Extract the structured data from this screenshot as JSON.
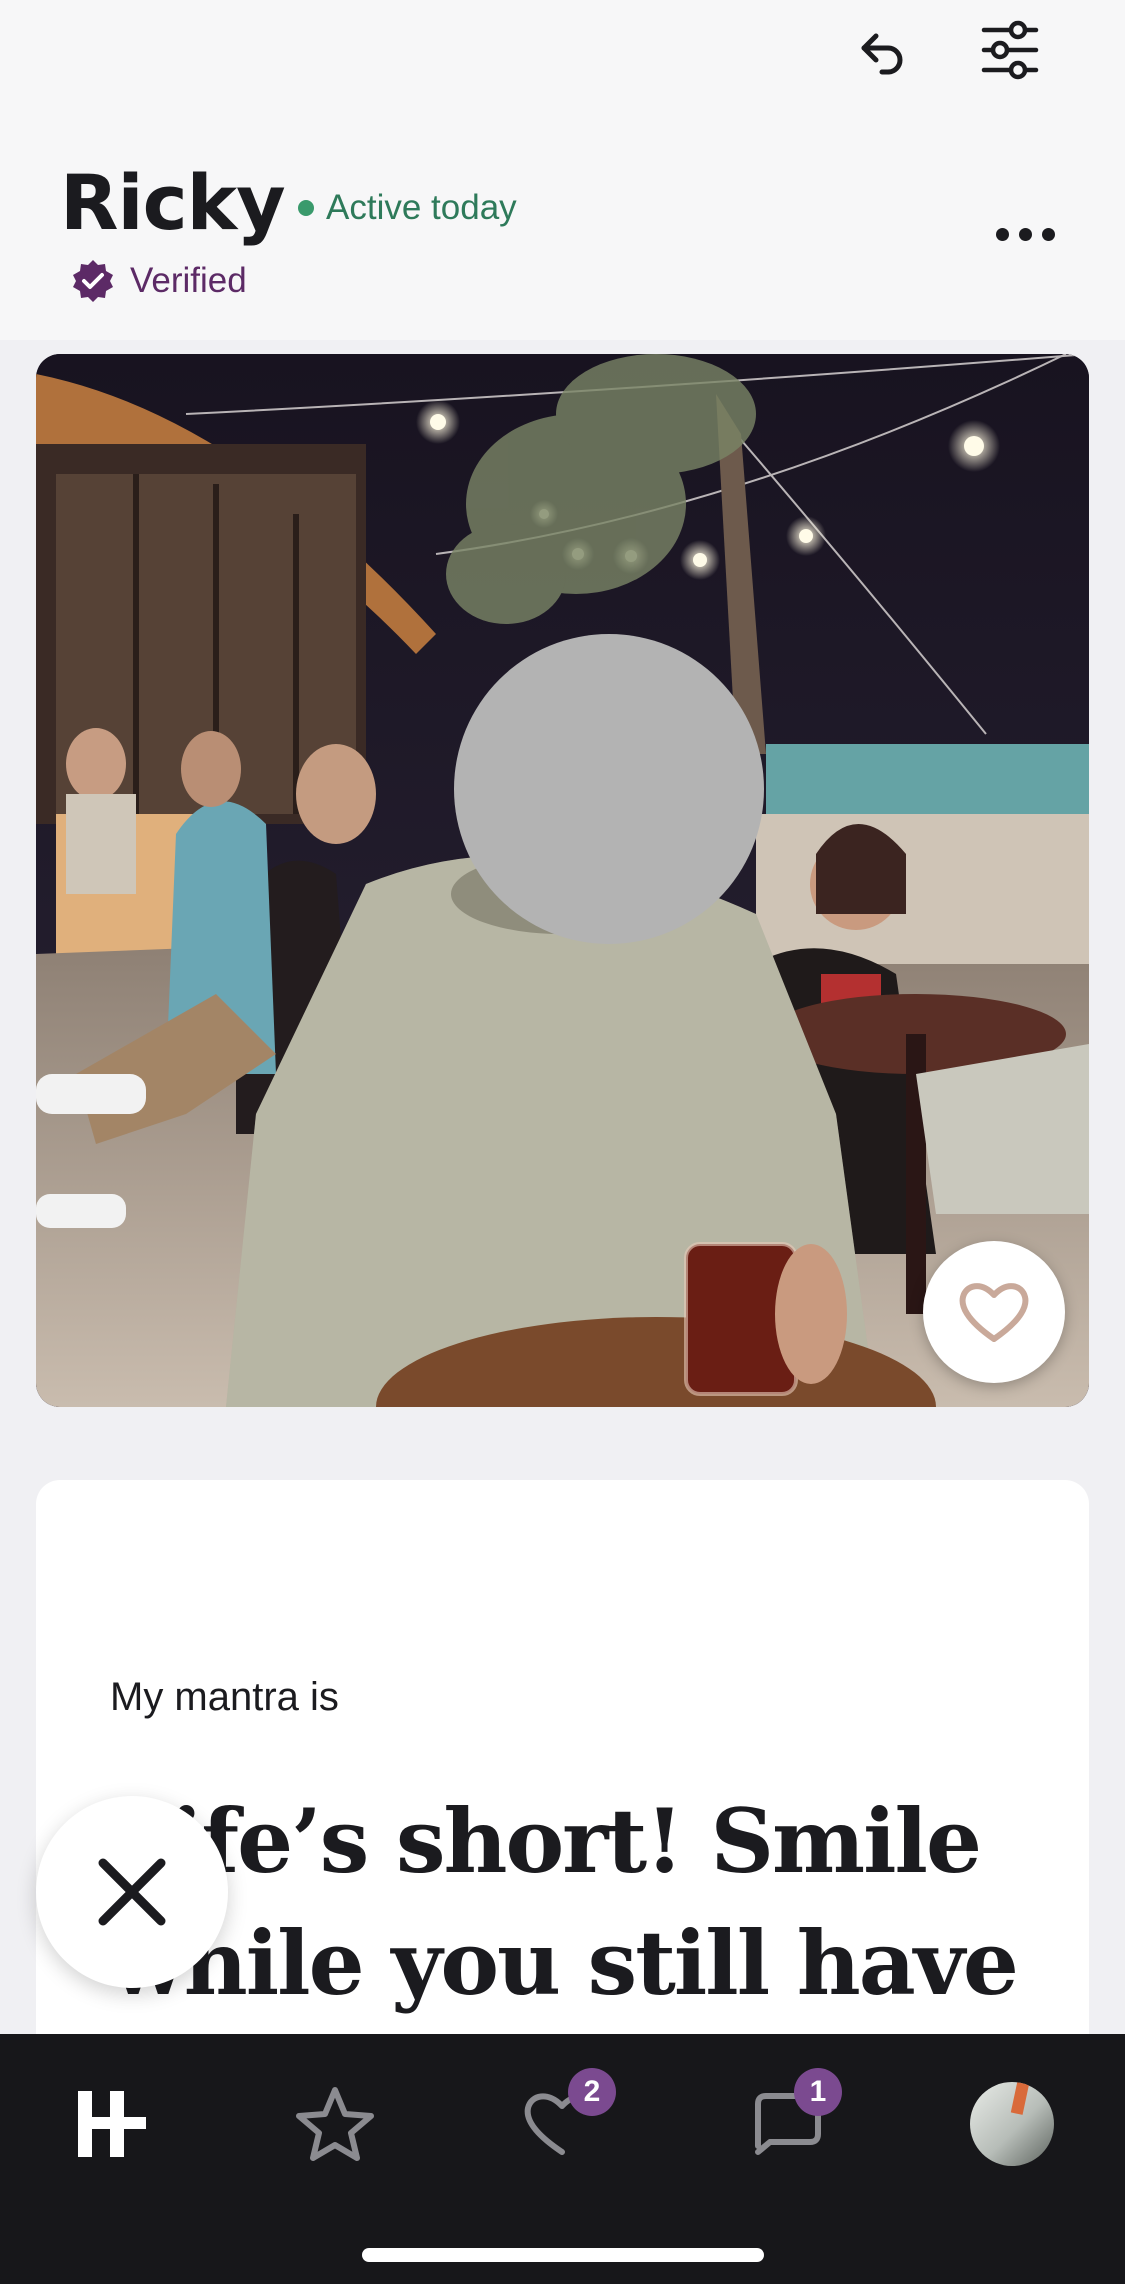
{
  "profile": {
    "name": "Ricky",
    "status": "Active today",
    "verified_label": "Verified"
  },
  "prompt": {
    "label": "My mantra is",
    "answer": "Life’s short! Smile while you still have"
  },
  "tabs": [
    {
      "name": "home",
      "icon": "hinge-logo-icon",
      "badge": ""
    },
    {
      "name": "standouts",
      "icon": "star-icon",
      "badge": ""
    },
    {
      "name": "likes-you",
      "icon": "heart-icon",
      "badge": "2"
    },
    {
      "name": "matches",
      "icon": "chat-icon",
      "badge": "1"
    },
    {
      "name": "profile",
      "icon": "avatar",
      "badge": ""
    }
  ],
  "colors": {
    "active_green": "#2e7a5a",
    "verified_purple": "#5c2a66",
    "badge_purple": "#7b4a90",
    "tabbar_bg": "#17171a"
  }
}
